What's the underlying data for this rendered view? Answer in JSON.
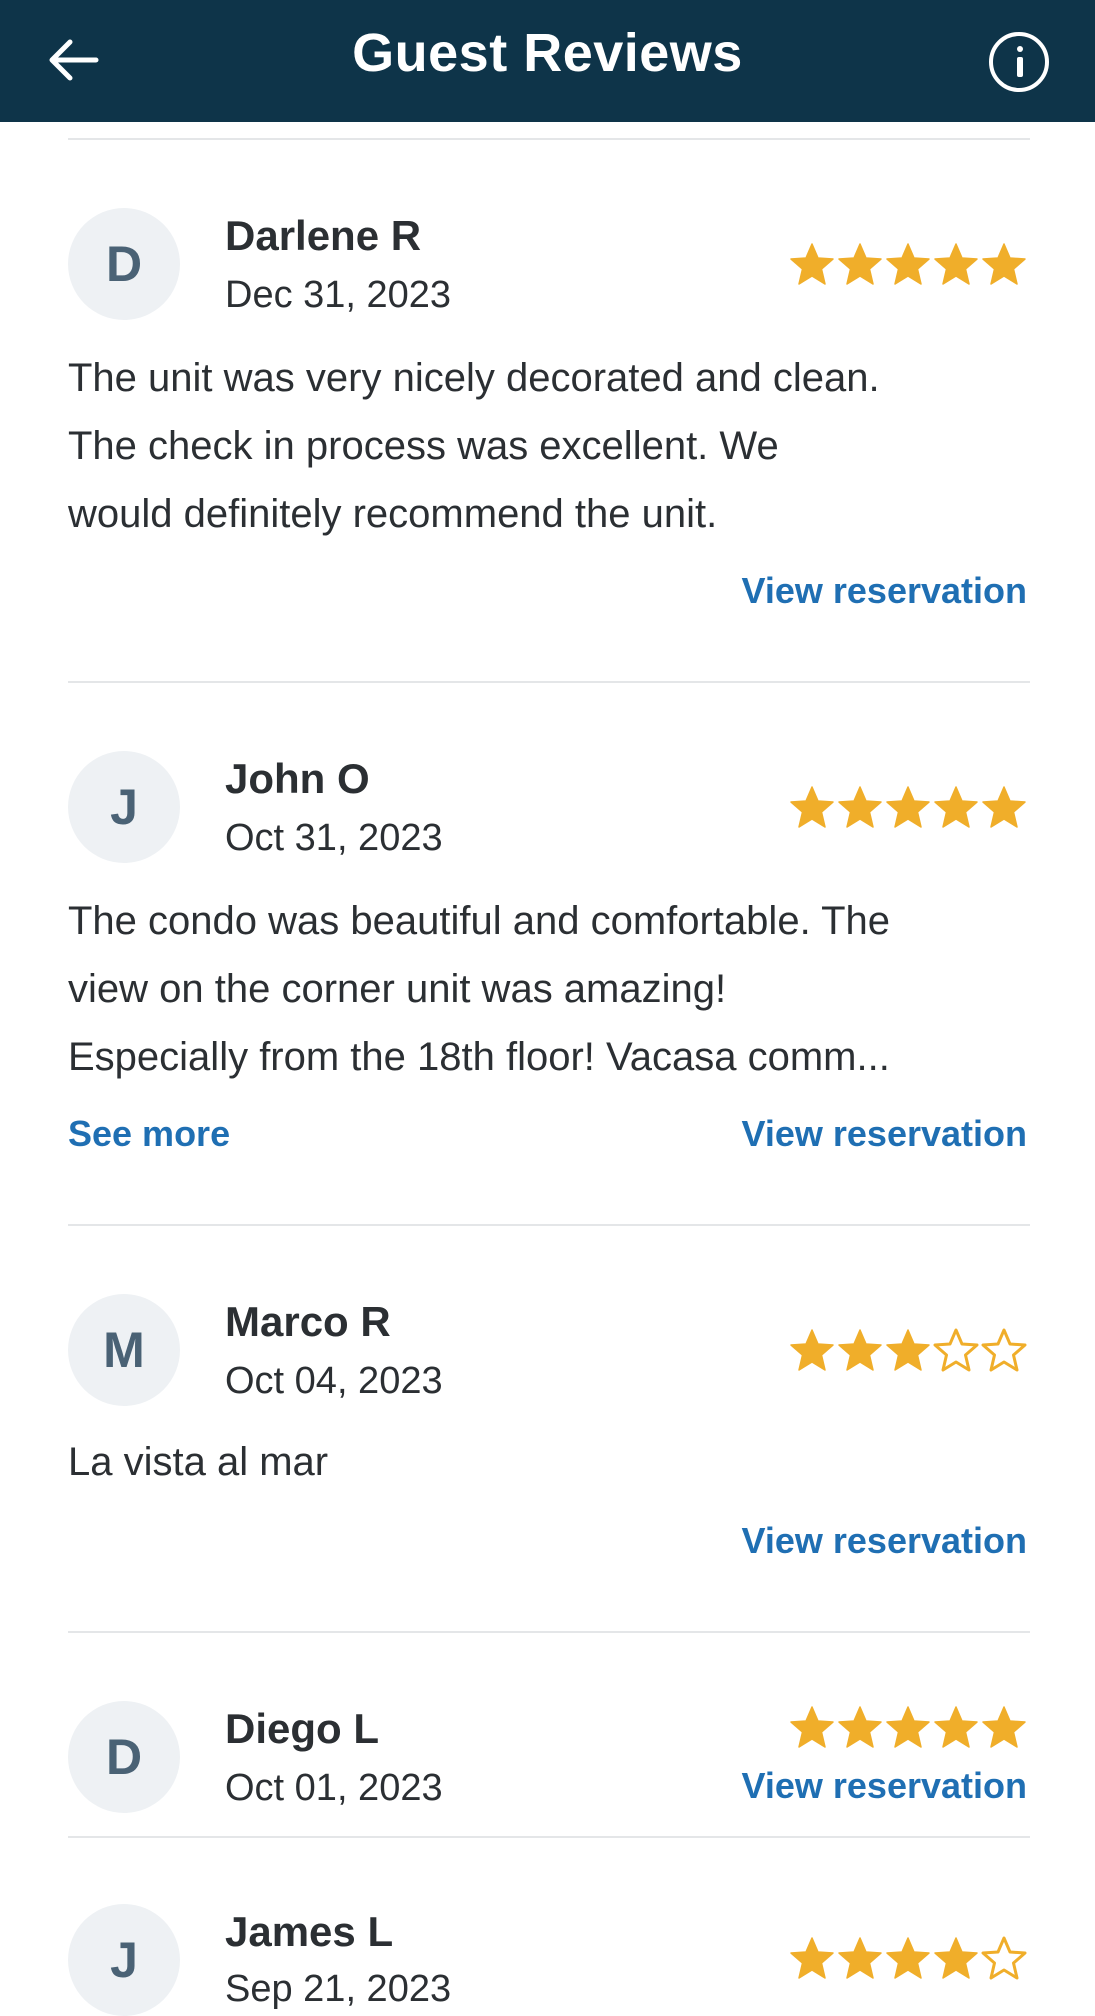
{
  "header": {
    "title": "Guest Reviews",
    "back_icon": "arrow-left-icon",
    "info_icon": "info-circle-icon",
    "background": "#0e3449"
  },
  "colors": {
    "star_filled": "#f0ae2a",
    "link": "#1f6fb3"
  },
  "reviews": [
    {
      "initial": "D",
      "name": "Darlene R",
      "date": "Dec 31, 2023",
      "rating": 5,
      "text_lines": [
        "The unit was very nicely decorated and clean.",
        "The check in process was excellent.  We",
        "would definitely recommend the unit."
      ],
      "see_more": "",
      "view_reservation": "View reservation"
    },
    {
      "initial": "J",
      "name": "John O",
      "date": "Oct 31, 2023",
      "rating": 5,
      "text_lines": [
        "The condo was beautiful and comfortable. The",
        "view on the corner unit was amazing!",
        "Especially from the 18th floor! Vacasa comm..."
      ],
      "see_more": "See more",
      "view_reservation": "View reservation"
    },
    {
      "initial": "M",
      "name": "Marco R",
      "date": "Oct 04, 2023",
      "rating": 3,
      "text_lines": [
        "La vista al mar"
      ],
      "see_more": "",
      "view_reservation": "View reservation"
    },
    {
      "initial": "D",
      "name": "Diego L",
      "date": "Oct 01, 2023",
      "rating": 5,
      "text_lines": [],
      "see_more": "",
      "view_reservation": "View reservation"
    },
    {
      "initial": "J",
      "name": "James L",
      "date": "Sep 21, 2023",
      "rating": 4,
      "text_lines": [],
      "see_more": "",
      "view_reservation": ""
    }
  ]
}
